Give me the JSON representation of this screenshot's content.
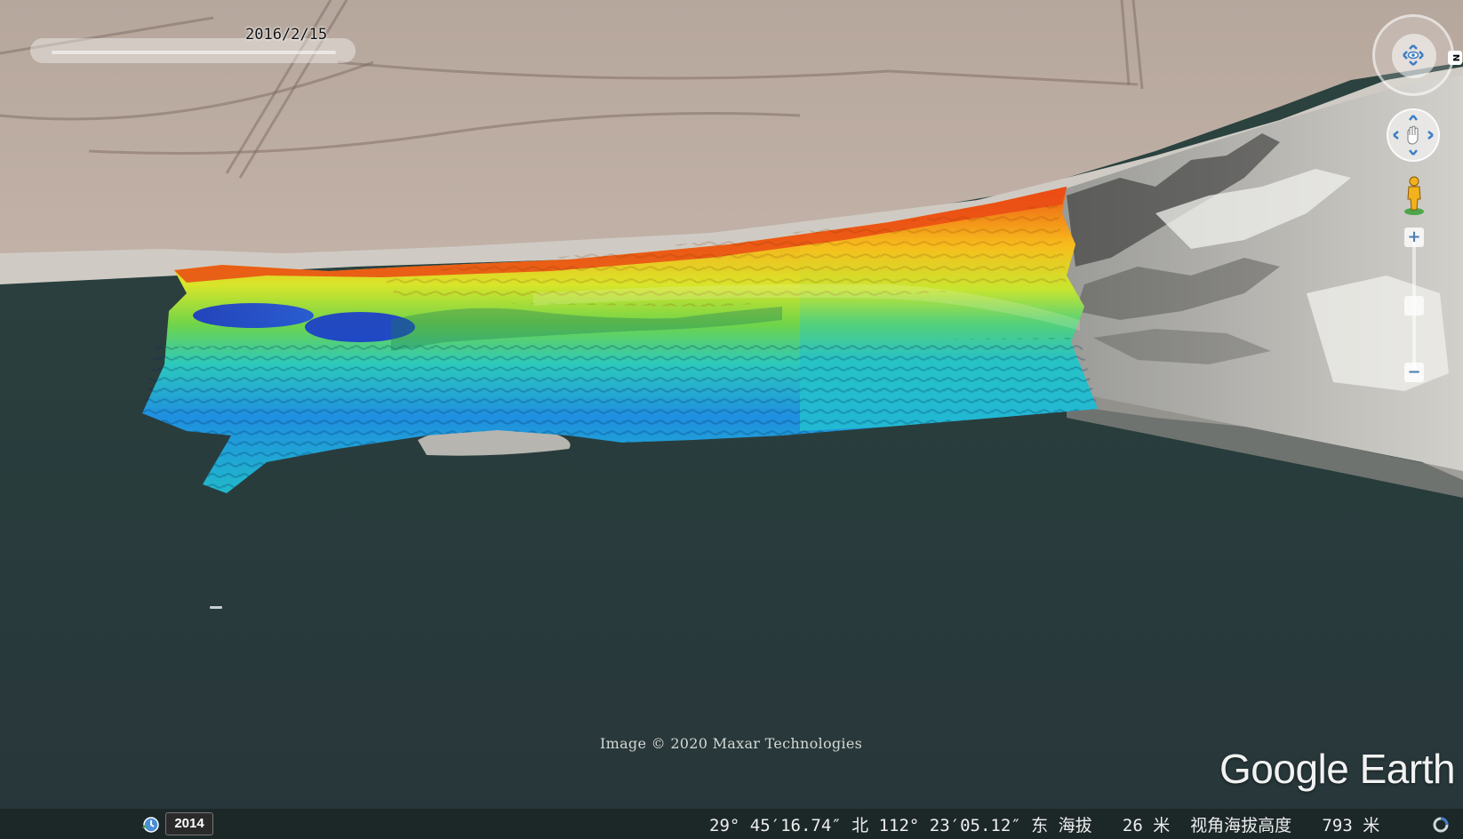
{
  "map": {
    "imagery_date": "2016/2/15",
    "attribution": "Image © 2020 Maxar Technologies",
    "brand": "Google Earth",
    "historical_year": "2014",
    "status": {
      "coordinates": "29° 45′16.74″ 北 112° 23′05.12″ 东 海拔   26 米  视角海拔高度   793 米"
    },
    "overlay": {
      "type": "bathymetry-colormap",
      "colors": [
        "#1a3fd6",
        "#1e8fe0",
        "#20c6d6",
        "#2ecf6a",
        "#a6e22a",
        "#f5e41d",
        "#f7a21b",
        "#ee4a12"
      ]
    },
    "icons": {
      "navigation": "look-around-eye-icon",
      "pan": "pan-hand-icon",
      "street_view": "pegman-icon",
      "zoom_in": "zoom-in-icon",
      "zoom_out": "zoom-out-icon",
      "history": "historical-clock-icon",
      "loading": "loading-spinner-icon"
    },
    "controls": {
      "north_label": "N",
      "zoom_in_label": "+",
      "zoom_out_label": "−"
    }
  }
}
